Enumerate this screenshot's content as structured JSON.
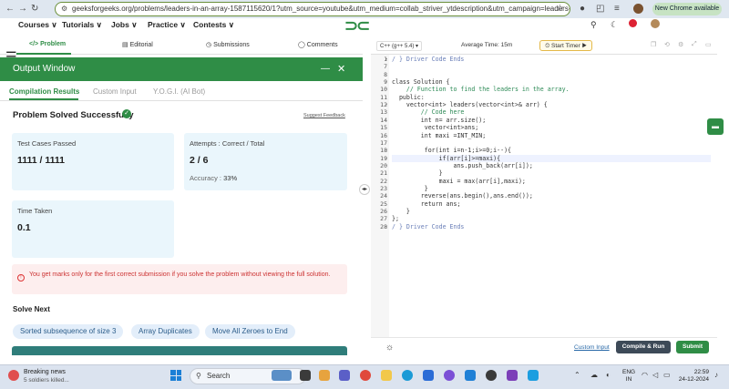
{
  "browser": {
    "url": "geeksforgeeks.org/problems/leaders-in-an-array-1587115620/1?utm_source=youtube&utm_medium=collab_striver_ytdescription&utm_campaign=leaders-in-...",
    "update_badge": "New Chrome available",
    "update_icon": "⋮"
  },
  "gfg_nav": {
    "items": [
      "Courses ∨",
      "Tutorials ∨",
      "Jobs ∨",
      "Practice ∨",
      "Contests ∨"
    ]
  },
  "problem_tabs": {
    "problem": "</> Problem",
    "editorial": "Editorial",
    "submissions": "Submissions",
    "comments": "Comments"
  },
  "output": {
    "title": "Output Window",
    "minimize": "—",
    "close": "✕",
    "tabs": [
      "Compilation Results",
      "Custom Input",
      "Y.O.G.I. (AI Bot)"
    ],
    "status": "Problem Solved Successfully",
    "suggest": "Suggest Feedback",
    "test_cases_label": "Test Cases Passed",
    "test_cases_value": "1111 / 1111",
    "attempts_label": "Attempts : Correct / Total",
    "attempts_value": "2 / 6",
    "accuracy_label": "Accuracy :",
    "accuracy_value": "33%",
    "time_label": "Time Taken",
    "time_value": "0.1",
    "warning": "You get marks only for the first correct submission if you solve the problem without viewing the full solution.",
    "solve_next": "Solve Next",
    "chips": [
      "Sorted subsequence of size 3",
      "Array Duplicates",
      "Move All Zeroes to End"
    ]
  },
  "editor": {
    "language": "C++ (g++ 5.4)",
    "avg_time": "Average Time: 15m",
    "timer": "Start Timer",
    "lines": [
      {
        "n": "1",
        "code": "/ } Driver Code Ends",
        "fold": true
      },
      {
        "n": "7",
        "code": ""
      },
      {
        "n": "8",
        "code": ""
      },
      {
        "n": "9",
        "code": "class Solution {",
        "fold": true
      },
      {
        "n": "10",
        "code": "    // Function to find the leaders in the array."
      },
      {
        "n": "11",
        "code": "  public:"
      },
      {
        "n": "12",
        "code": "    vector<int> leaders(vector<int>& arr) {",
        "fold": true
      },
      {
        "n": "13",
        "code": "        // Code here"
      },
      {
        "n": "14",
        "code": "        int n= arr.size();"
      },
      {
        "n": "15",
        "code": "         vector<int>ans;"
      },
      {
        "n": "16",
        "code": "        int maxi =INT_MIN;"
      },
      {
        "n": "17",
        "code": ""
      },
      {
        "n": "18",
        "code": "         for(int i=n-1;i>=0;i--){",
        "fold": true
      },
      {
        "n": "19",
        "code": "             if(arr[i]>=maxi){",
        "fold": true
      },
      {
        "n": "20",
        "code": "                 ans.push_back(arr[i]);"
      },
      {
        "n": "21",
        "code": "             }"
      },
      {
        "n": "22",
        "code": "             maxi = max(arr[i],maxi);"
      },
      {
        "n": "23",
        "code": "         }"
      },
      {
        "n": "24",
        "code": "        reverse(ans.begin(),ans.end());"
      },
      {
        "n": "25",
        "code": "        return ans;"
      },
      {
        "n": "26",
        "code": "    }"
      },
      {
        "n": "27",
        "code": "};"
      },
      {
        "n": "28",
        "code": "/ } Driver Code Ends",
        "fold": true
      }
    ],
    "custom_input": "Custom Input",
    "compile_run": "Compile & Run",
    "submit": "Submit"
  },
  "taskbar": {
    "news_title": "Breaking news",
    "news_sub": "5 soldiers killed...",
    "search": "Search",
    "lang_top": "ENG",
    "lang_bottom": "IN",
    "time": "22:59",
    "date": "24-12-2024"
  },
  "colors": {
    "accent": "#2f8d46",
    "chip_bg": "#e3eefa",
    "card_bg": "#eaf6fc",
    "warning_bg": "#fdeeee"
  }
}
